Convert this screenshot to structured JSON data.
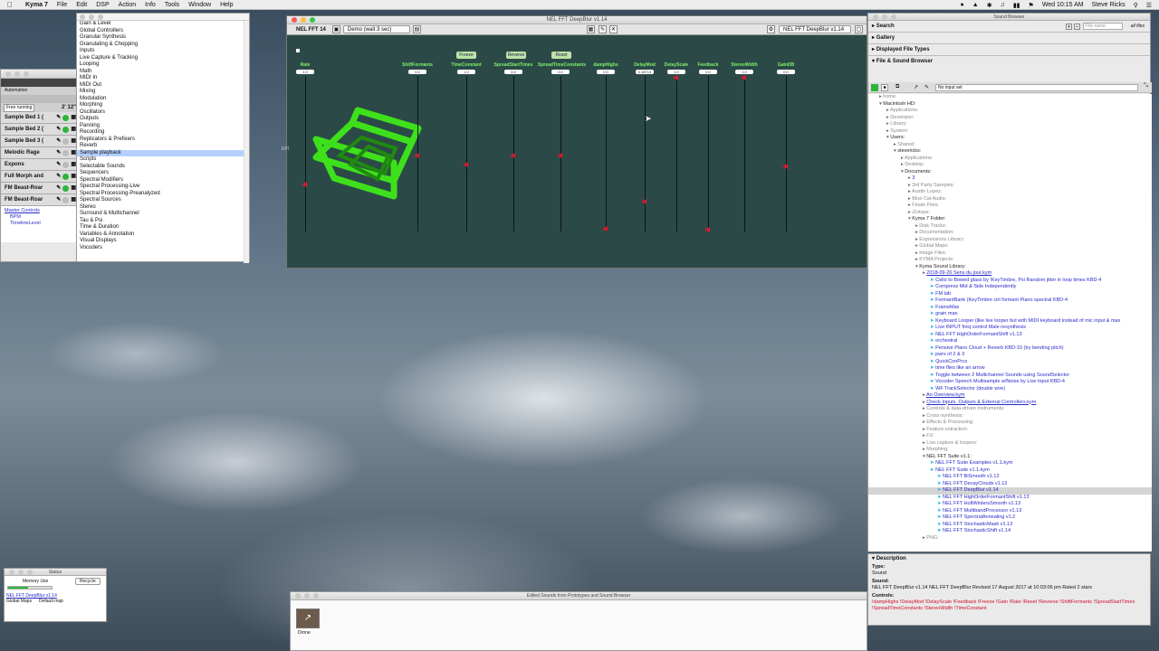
{
  "menubar": {
    "app": "Kyma 7",
    "items": [
      "File",
      "Edit",
      "DSP",
      "Action",
      "Info",
      "Tools",
      "Window",
      "Help"
    ],
    "clock": "Wed 10:15 AM",
    "user": "Steve Ricks"
  },
  "left_panel": {
    "automation": "Automation",
    "free_running": "Free running",
    "time": "2' 12\"",
    "tracks": [
      "Sample Bed 1 (",
      "Sample Bed 2 (",
      "Sample Bed 3 (",
      "Melodic Rage",
      "Expons",
      "Full Morph and",
      "FM Beast-Roar",
      "FM Beast-Roar"
    ],
    "master_controls": "Master Controls",
    "bpm": "BPM",
    "timeline_level": "TimelineLevel"
  },
  "categories": {
    "items": [
      "Gain & Level",
      "Global Controllers",
      "Granular Synthesis",
      "Granulating & Chopping",
      "Inputs",
      "Live Capture & Tracking",
      "Looping",
      "Math",
      "MIDI In",
      "MIDI Out",
      "Mixing",
      "Modulation",
      "Morphing",
      "Oscillators",
      "Outputs",
      "Panning",
      "Recording",
      "Replicators & Prefixers",
      "Reverb",
      "Sample playback",
      "Scripts",
      "Selectable Sounds",
      "Sequencers",
      "Spectral Modifiers",
      "Spectral Processing-Live",
      "Spectral Processing-Preanalyzed",
      "Spectral Sources",
      "Stereo",
      "Surround & Multichannel",
      "Tau & Psi",
      "Time & Duration",
      "Variables & Annotation",
      "Visual Displays",
      "Vocoders"
    ],
    "selected": "Sample playback"
  },
  "synth": {
    "title": "NEL FFT DeepBlur v1.14",
    "window_name": "NEL FFT 14",
    "preset": "Demo (wait 3 sec)",
    "sound": "NEL FFT DeepBlur v1.14",
    "buttons": [
      "Freeze",
      "Reverse",
      "Reset"
    ],
    "params": [
      {
        "name": "Rate",
        "value": "1.0",
        "level": 0.3
      },
      {
        "name": "ShiftFormants",
        "value": "0.0",
        "level": 0.49
      },
      {
        "name": "TimeConstant",
        "value": "1.0",
        "level": 0.43
      },
      {
        "name": "SpreadStartTimes",
        "value": "0.0",
        "level": 0.49
      },
      {
        "name": "SpreadTimeConstants",
        "value": "0.0",
        "level": 0.49
      },
      {
        "name": "dampHighs",
        "value": "0.0",
        "level": 0.02
      },
      {
        "name": "DelayMod",
        "value": "0.18713",
        "level": 0.19
      },
      {
        "name": "DelayScale",
        "value": "1.0",
        "level": 0.99
      },
      {
        "name": "Feedback",
        "value": "0.0",
        "level": 0.01
      },
      {
        "name": "StereoWidth",
        "value": "1.0",
        "level": 0.99
      },
      {
        "name": "GainDB",
        "value": "0.0",
        "level": 0.42
      }
    ]
  },
  "browser": {
    "title": "Sound Browser",
    "search": "Search",
    "file_name_placeholder": "File name",
    "all_files": "all files",
    "gallery": "Gallery",
    "displayed_file_types": "Displayed File Types",
    "file_sound_browser": "File & Sound Browser",
    "no_input": "No input set",
    "tree": [
      {
        "t": "home",
        "c": "g",
        "i": 1
      },
      {
        "t": "Macintosh HD:",
        "c": "d",
        "i": 1
      },
      {
        "t": "Applications:",
        "c": "g",
        "i": 2
      },
      {
        "t": "Developer:",
        "c": "g",
        "i": 2
      },
      {
        "t": "Library:",
        "c": "g",
        "i": 2
      },
      {
        "t": "System:",
        "c": "g",
        "i": 2
      },
      {
        "t": "Users:",
        "c": "d",
        "i": 2
      },
      {
        "t": "Shared:",
        "c": "g",
        "i": 3
      },
      {
        "t": "stevericks:",
        "c": "d",
        "i": 3
      },
      {
        "t": "Applications:",
        "c": "g",
        "i": 4
      },
      {
        "t": "Desktop:",
        "c": "g",
        "i": 4
      },
      {
        "t": "Documents:",
        "c": "d",
        "i": 4
      },
      {
        "t": "3",
        "c": "b",
        "i": 5
      },
      {
        "t": "3rd Party Samples:",
        "c": "g",
        "i": 5
      },
      {
        "t": "Austin Lopez:",
        "c": "g",
        "i": 5
      },
      {
        "t": "Blue Cat Audio:",
        "c": "g",
        "i": 5
      },
      {
        "t": "Finale Files:",
        "c": "g",
        "i": 5
      },
      {
        "t": "iZotope:",
        "c": "g",
        "i": 5
      },
      {
        "t": "Kyma 7 Folder:",
        "c": "d",
        "i": 5
      },
      {
        "t": "Disk Tracks:",
        "c": "g",
        "i": 6
      },
      {
        "t": "Documentation:",
        "c": "g",
        "i": 6
      },
      {
        "t": "Expressions Library:",
        "c": "g",
        "i": 6
      },
      {
        "t": "Global Maps:",
        "c": "g",
        "i": 6
      },
      {
        "t": "Image Files:",
        "c": "g",
        "i": 6
      },
      {
        "t": "KYMA Projects:",
        "c": "g",
        "i": 6
      },
      {
        "t": "Kyma Sound Library:",
        "c": "d",
        "i": 6
      },
      {
        "t": "2018-09-26 Sens du jour.kym",
        "c": "b",
        "i": 7
      },
      {
        "t": "Cello to Bowed glass by !KeyTimbre, Psi Random jitter in loop times KBD-4",
        "c": "b",
        "i": 8
      },
      {
        "t": "Compress Mid & Side Independently",
        "c": "b",
        "i": 8
      },
      {
        "t": "FM lab",
        "c": "b",
        "i": 8
      },
      {
        "t": "FormantBank (KeyTimbre ctrl formant Piano spectral KBD-4",
        "c": "b",
        "i": 8
      },
      {
        "t": "FrameMax",
        "c": "b",
        "i": 8
      },
      {
        "t": "grain man",
        "c": "b",
        "i": 8
      },
      {
        "t": "Keyboard Looper (like live looper but with MIDI keyboard instead of mic input & max",
        "c": "b",
        "i": 8
      },
      {
        "t": "Live INPUT freq control Male resynthesis",
        "c": "b",
        "i": 8
      },
      {
        "t": "NEL FFT HighOrderFormantShift v1.13",
        "c": "b",
        "i": 8
      },
      {
        "t": "orchestral",
        "c": "b",
        "i": 8
      },
      {
        "t": "Pensive Piano Cloud + Reverb KBD-10 (try bending pitch)",
        "c": "b",
        "i": 8
      },
      {
        "t": "pwrs of 2 & 3",
        "c": "b",
        "i": 8
      },
      {
        "t": "QuickConPrcs",
        "c": "b",
        "i": 8
      },
      {
        "t": "time flies like an arrow",
        "c": "b",
        "i": 8
      },
      {
        "t": "Toggle between 2 Multichannel Sounds using SoundSelector",
        "c": "b",
        "i": 8
      },
      {
        "t": "Vocoder Speech Multisample w/Noise by Live Input KBD-4",
        "c": "b",
        "i": 8
      },
      {
        "t": "WF TrackSelector (double wire)",
        "c": "b",
        "i": 8
      },
      {
        "t": "An Overview.kym",
        "c": "b",
        "i": 7
      },
      {
        "t": "Check Inputs, Outputs & External Controllers.kym",
        "c": "b",
        "i": 7
      },
      {
        "t": "Controls & data-driven instruments:",
        "c": "g",
        "i": 7
      },
      {
        "t": "Cross-synthesis:",
        "c": "g",
        "i": 7
      },
      {
        "t": "Effects & Processing:",
        "c": "g",
        "i": 7
      },
      {
        "t": "Feature extraction:",
        "c": "g",
        "i": 7
      },
      {
        "t": "FX:",
        "c": "g",
        "i": 7
      },
      {
        "t": "Live capture & loopers:",
        "c": "g",
        "i": 7
      },
      {
        "t": "Morphing:",
        "c": "g",
        "i": 7
      },
      {
        "t": "NEL FFT Suite v1.1:",
        "c": "d",
        "i": 7
      },
      {
        "t": "NEL FFT Suite Examples v1.1.kym",
        "c": "b",
        "i": 8
      },
      {
        "t": "NEL FFT Suite v1.1.kym",
        "c": "b",
        "i": 8
      },
      {
        "t": "NEL FFT BiSmooth v1.12",
        "c": "b",
        "i": 9
      },
      {
        "t": "NEL FFT DecayClouds v1.12",
        "c": "b",
        "i": 9
      },
      {
        "t": "NEL FFT DeepBlur v1.14",
        "c": "b",
        "i": 9,
        "sel": true
      },
      {
        "t": "NEL FFT HighOrderFormantShift v1.13",
        "c": "b",
        "i": 9
      },
      {
        "t": "NEL FFT HoltWintersSmooth v1.13",
        "c": "b",
        "i": 9
      },
      {
        "t": "NEL FFT MultibandProcessor v1.13",
        "c": "b",
        "i": 9
      },
      {
        "t": "NEL FFT SpectralAnnealing v1.2",
        "c": "b",
        "i": 9
      },
      {
        "t": "NEL FFT StochasticMask v1.13",
        "c": "b",
        "i": 9
      },
      {
        "t": "NEL FFT StochasticShift v1.14",
        "c": "b",
        "i": 9
      },
      {
        "t": "PNG:",
        "c": "g",
        "i": 7
      }
    ]
  },
  "description": {
    "title": "Description",
    "type_label": "Type:",
    "type": "Sound",
    "sound_label": "Sound:",
    "sound": "NEL FFT DeepBlur v1.14 NEL FFT DeepBlur Revised 17 August 2017 at 10:03:06 pm Rated 2 stars",
    "controls_label": "Controls:",
    "controls": "!dampHighs !DelayMod !DelayScale !Feedback !Freeze !Gain !Rate  !Reset !Reverse !ShiftFormants !SpreadStartTimes  !SpreadTimeConstants !StereoWidth !TimeConstant"
  },
  "status": {
    "title": "Status",
    "memory_use": "Memory Use",
    "recycle": "Recycle",
    "sound": "NEL FFT DeepBlur v1.14",
    "global_maps": "Global Maps",
    "map": "Default.map"
  },
  "edited": {
    "title": "Edited Sounds from Prototypes and Sound Browser",
    "item": "Drone"
  },
  "colors": {
    "synth_bg": "#2b4a47",
    "param_label": "#7ff06a",
    "fader_knob": "#d8182d",
    "cube": "#3ee01b",
    "link_blue": "#2a2ac8"
  }
}
